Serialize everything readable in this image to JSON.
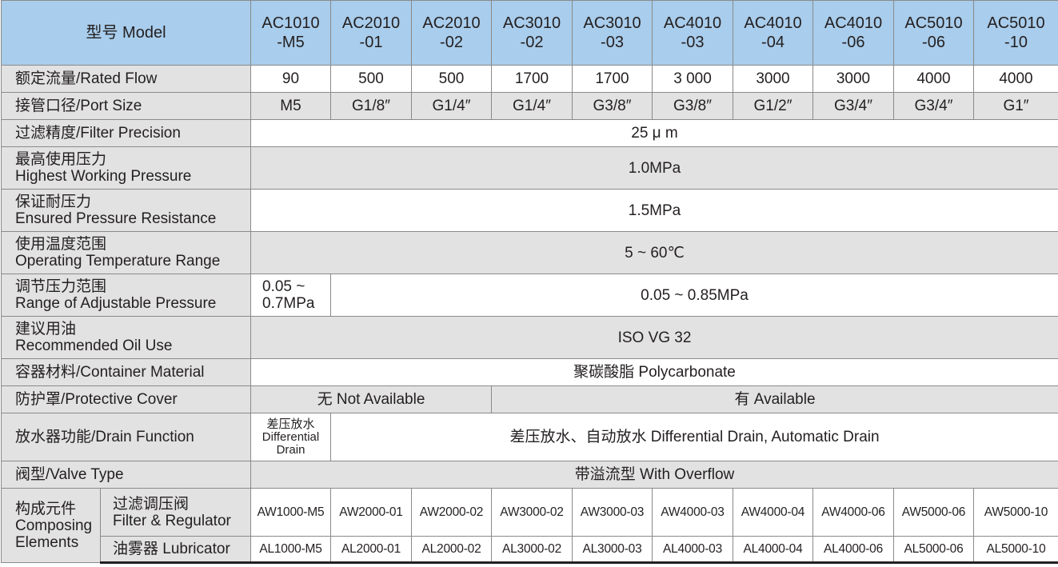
{
  "header": {
    "label": "型号 Model",
    "models": [
      {
        "top": "AC1010",
        "bottom": "-M5"
      },
      {
        "top": "AC2010",
        "bottom": "-01"
      },
      {
        "top": "AC2010",
        "bottom": "-02"
      },
      {
        "top": "AC3010",
        "bottom": "-02"
      },
      {
        "top": "AC3010",
        "bottom": "-03"
      },
      {
        "top": "AC4010",
        "bottom": "-03"
      },
      {
        "top": "AC4010",
        "bottom": "-04"
      },
      {
        "top": "AC4010",
        "bottom": "-06"
      },
      {
        "top": "AC5010",
        "bottom": "-06"
      },
      {
        "top": "AC5010",
        "bottom": "-10"
      }
    ]
  },
  "rated_flow": {
    "label": "额定流量/Rated Flow",
    "values": [
      "90",
      "500",
      "500",
      "1700",
      "1700",
      "3 000",
      "3000",
      "3000",
      "4000",
      "4000"
    ]
  },
  "port_size": {
    "label": "接管口径/Port Size",
    "values": [
      "M5",
      "G1/8″",
      "G1/4″",
      "G1/4″",
      "G3/8″",
      "G3/8″",
      "G1/2″",
      "G3/4″",
      "G3/4″",
      "G1″"
    ]
  },
  "filter_precision": {
    "label": "过滤精度/Filter Precision",
    "value": "25 μ m"
  },
  "highest_pressure": {
    "label_cn": "最高使用压力",
    "label_en": "Highest Working Pressure",
    "value": "1.0MPa"
  },
  "ensured_pressure": {
    "label_cn": "保证耐压力",
    "label_en": "Ensured Pressure Resistance",
    "value": "1.5MPa"
  },
  "temperature": {
    "label_cn": "使用温度范围",
    "label_en": "Operating Temperature Range",
    "value": "5 ~ 60℃"
  },
  "adjustable_pressure": {
    "label_cn": "调节压力范围",
    "label_en": "Range of Adjustable Pressure",
    "first_line1": "0.05 ~",
    "first_line2": "0.7MPa",
    "rest": "0.05 ~ 0.85MPa"
  },
  "oil": {
    "label_cn": "建议用油",
    "label_en": "Recommended Oil Use",
    "value": "ISO VG 32"
  },
  "container": {
    "label": "容器材料/Container Material",
    "value": "聚碳酸脂  Polycarbonate"
  },
  "cover": {
    "label": "防护罩/Protective Cover",
    "not_available": "无  Not Available",
    "available": "有  Available"
  },
  "drain": {
    "label": "放水器功能/Drain Function",
    "first_line1": "差压放水",
    "first_line2": "Differential",
    "first_line3": "Drain",
    "rest": "差压放水、自动放水  Differential Drain, Automatic Drain"
  },
  "valve": {
    "label": "阀型/Valve Type",
    "value": "带溢流型  With Overflow"
  },
  "composing": {
    "label_line1": "构成元件",
    "label_line2": "Composing",
    "label_line3": "Elements",
    "regulator_cn": "过滤调压阀",
    "regulator_en": "Filter & Regulator",
    "regulator_values": [
      "AW1000-M5",
      "AW2000-01",
      "AW2000-02",
      "AW3000-02",
      "AW3000-03",
      "AW4000-03",
      "AW4000-04",
      "AW4000-06",
      "AW5000-06",
      "AW5000-10"
    ],
    "lubricator_label": "油雾器 Lubricator",
    "lubricator_values": [
      "AL1000-M5",
      "AL2000-01",
      "AL2000-02",
      "AL3000-02",
      "AL3000-03",
      "AL4000-03",
      "AL4000-04",
      "AL4000-06",
      "AL5000-06",
      "AL5000-10"
    ]
  }
}
